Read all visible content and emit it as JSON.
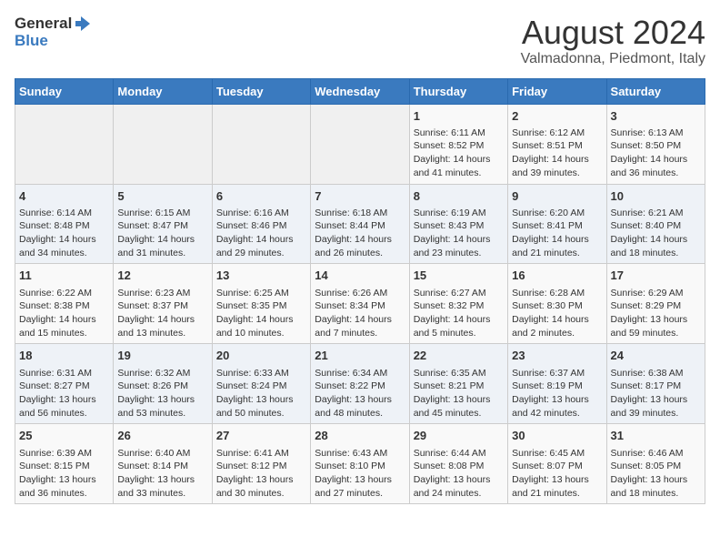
{
  "logo": {
    "text_general": "General",
    "text_blue": "Blue"
  },
  "title": "August 2024",
  "subtitle": "Valmadonna, Piedmont, Italy",
  "days_of_week": [
    "Sunday",
    "Monday",
    "Tuesday",
    "Wednesday",
    "Thursday",
    "Friday",
    "Saturday"
  ],
  "weeks": [
    [
      {
        "day": "",
        "info": ""
      },
      {
        "day": "",
        "info": ""
      },
      {
        "day": "",
        "info": ""
      },
      {
        "day": "",
        "info": ""
      },
      {
        "day": "1",
        "info": "Sunrise: 6:11 AM\nSunset: 8:52 PM\nDaylight: 14 hours and 41 minutes."
      },
      {
        "day": "2",
        "info": "Sunrise: 6:12 AM\nSunset: 8:51 PM\nDaylight: 14 hours and 39 minutes."
      },
      {
        "day": "3",
        "info": "Sunrise: 6:13 AM\nSunset: 8:50 PM\nDaylight: 14 hours and 36 minutes."
      }
    ],
    [
      {
        "day": "4",
        "info": "Sunrise: 6:14 AM\nSunset: 8:48 PM\nDaylight: 14 hours and 34 minutes."
      },
      {
        "day": "5",
        "info": "Sunrise: 6:15 AM\nSunset: 8:47 PM\nDaylight: 14 hours and 31 minutes."
      },
      {
        "day": "6",
        "info": "Sunrise: 6:16 AM\nSunset: 8:46 PM\nDaylight: 14 hours and 29 minutes."
      },
      {
        "day": "7",
        "info": "Sunrise: 6:18 AM\nSunset: 8:44 PM\nDaylight: 14 hours and 26 minutes."
      },
      {
        "day": "8",
        "info": "Sunrise: 6:19 AM\nSunset: 8:43 PM\nDaylight: 14 hours and 23 minutes."
      },
      {
        "day": "9",
        "info": "Sunrise: 6:20 AM\nSunset: 8:41 PM\nDaylight: 14 hours and 21 minutes."
      },
      {
        "day": "10",
        "info": "Sunrise: 6:21 AM\nSunset: 8:40 PM\nDaylight: 14 hours and 18 minutes."
      }
    ],
    [
      {
        "day": "11",
        "info": "Sunrise: 6:22 AM\nSunset: 8:38 PM\nDaylight: 14 hours and 15 minutes."
      },
      {
        "day": "12",
        "info": "Sunrise: 6:23 AM\nSunset: 8:37 PM\nDaylight: 14 hours and 13 minutes."
      },
      {
        "day": "13",
        "info": "Sunrise: 6:25 AM\nSunset: 8:35 PM\nDaylight: 14 hours and 10 minutes."
      },
      {
        "day": "14",
        "info": "Sunrise: 6:26 AM\nSunset: 8:34 PM\nDaylight: 14 hours and 7 minutes."
      },
      {
        "day": "15",
        "info": "Sunrise: 6:27 AM\nSunset: 8:32 PM\nDaylight: 14 hours and 5 minutes."
      },
      {
        "day": "16",
        "info": "Sunrise: 6:28 AM\nSunset: 8:30 PM\nDaylight: 14 hours and 2 minutes."
      },
      {
        "day": "17",
        "info": "Sunrise: 6:29 AM\nSunset: 8:29 PM\nDaylight: 13 hours and 59 minutes."
      }
    ],
    [
      {
        "day": "18",
        "info": "Sunrise: 6:31 AM\nSunset: 8:27 PM\nDaylight: 13 hours and 56 minutes."
      },
      {
        "day": "19",
        "info": "Sunrise: 6:32 AM\nSunset: 8:26 PM\nDaylight: 13 hours and 53 minutes."
      },
      {
        "day": "20",
        "info": "Sunrise: 6:33 AM\nSunset: 8:24 PM\nDaylight: 13 hours and 50 minutes."
      },
      {
        "day": "21",
        "info": "Sunrise: 6:34 AM\nSunset: 8:22 PM\nDaylight: 13 hours and 48 minutes."
      },
      {
        "day": "22",
        "info": "Sunrise: 6:35 AM\nSunset: 8:21 PM\nDaylight: 13 hours and 45 minutes."
      },
      {
        "day": "23",
        "info": "Sunrise: 6:37 AM\nSunset: 8:19 PM\nDaylight: 13 hours and 42 minutes."
      },
      {
        "day": "24",
        "info": "Sunrise: 6:38 AM\nSunset: 8:17 PM\nDaylight: 13 hours and 39 minutes."
      }
    ],
    [
      {
        "day": "25",
        "info": "Sunrise: 6:39 AM\nSunset: 8:15 PM\nDaylight: 13 hours and 36 minutes."
      },
      {
        "day": "26",
        "info": "Sunrise: 6:40 AM\nSunset: 8:14 PM\nDaylight: 13 hours and 33 minutes."
      },
      {
        "day": "27",
        "info": "Sunrise: 6:41 AM\nSunset: 8:12 PM\nDaylight: 13 hours and 30 minutes."
      },
      {
        "day": "28",
        "info": "Sunrise: 6:43 AM\nSunset: 8:10 PM\nDaylight: 13 hours and 27 minutes."
      },
      {
        "day": "29",
        "info": "Sunrise: 6:44 AM\nSunset: 8:08 PM\nDaylight: 13 hours and 24 minutes."
      },
      {
        "day": "30",
        "info": "Sunrise: 6:45 AM\nSunset: 8:07 PM\nDaylight: 13 hours and 21 minutes."
      },
      {
        "day": "31",
        "info": "Sunrise: 6:46 AM\nSunset: 8:05 PM\nDaylight: 13 hours and 18 minutes."
      }
    ]
  ]
}
